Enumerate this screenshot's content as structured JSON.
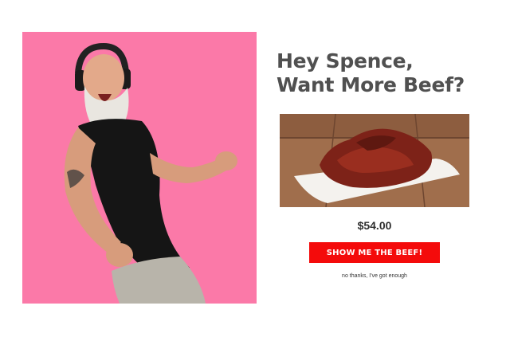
{
  "offer": {
    "headline_line1": "Hey Spence,",
    "headline_line2": "Want More Beef?",
    "price": "$54.00",
    "cta_label": "SHOW ME THE BEEF!",
    "decline_label": "no thanks, I've got enough"
  },
  "colors": {
    "hero_background": "#fb79a8",
    "cta_background": "#f40b0b",
    "headline_text": "#505050"
  }
}
